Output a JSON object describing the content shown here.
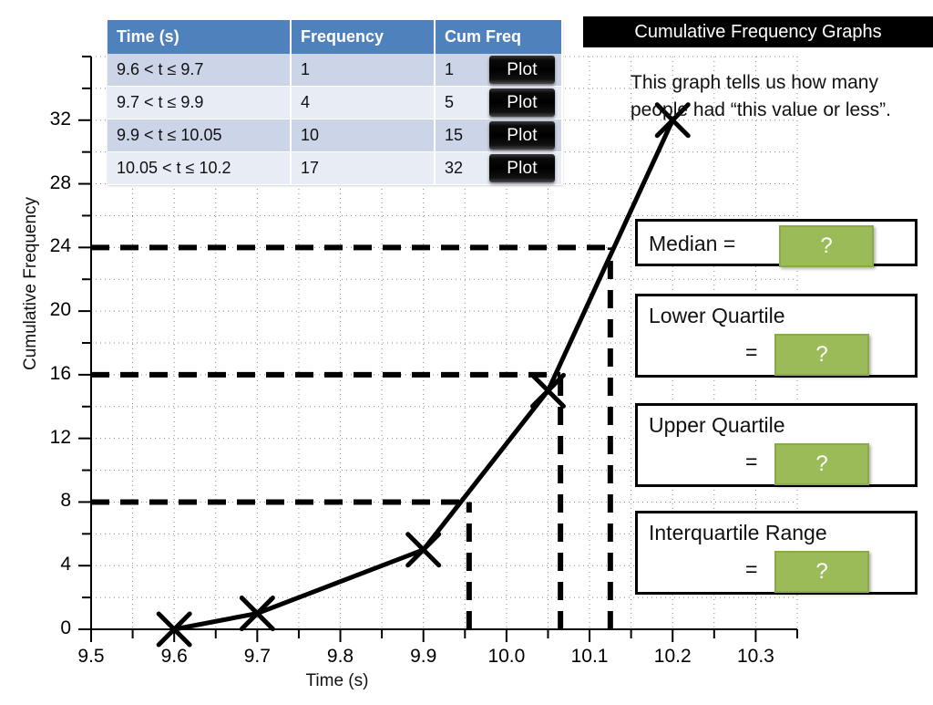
{
  "header": {
    "title": "Cumulative Frequency Graphs",
    "blurb": "This graph tells us how many people had “this value or less”."
  },
  "table": {
    "columns": [
      "Time (s)",
      "Frequency",
      "Cum Freq"
    ],
    "rows": [
      {
        "time": "9.6 < t ≤ 9.7",
        "frequency": "1",
        "cum_freq": "1",
        "plot_label": "Plot"
      },
      {
        "time": "9.7 < t ≤ 9.9",
        "frequency": "4",
        "cum_freq": "5",
        "plot_label": "Plot"
      },
      {
        "time": "9.9 < t ≤ 10.05",
        "frequency": "10",
        "cum_freq": "15",
        "plot_label": "Plot"
      },
      {
        "time": "10.05 < t ≤ 10.2",
        "frequency": "17",
        "cum_freq": "32",
        "plot_label": "Plot"
      }
    ]
  },
  "answers": [
    {
      "label": "Median =",
      "eq": "",
      "value": "?"
    },
    {
      "label": "Lower Quartile",
      "eq": "=",
      "value": "?"
    },
    {
      "label": "Upper Quartile",
      "eq": "=",
      "value": "?"
    },
    {
      "label": "Interquartile Range",
      "eq": "=",
      "value": "?"
    }
  ],
  "colors": {
    "header_blue": "#4F81BD",
    "row_odd": "#ccd5e8",
    "row_even": "#e7ecf5",
    "answer_green": "#9BBB59",
    "title_bar": "#000000",
    "curve": "#000000"
  },
  "chart_data": {
    "type": "line",
    "title": "",
    "xlabel": "Time (s)",
    "ylabel": "Cumulative Frequency",
    "xlim": [
      9.5,
      10.35
    ],
    "ylim": [
      0,
      36
    ],
    "xticks": [
      9.5,
      9.6,
      9.7,
      9.8,
      9.9,
      10.0,
      10.1,
      10.2,
      10.3
    ],
    "xtick_labels": [
      "9.5",
      "9.6",
      "9.7",
      "9.8",
      "9.9",
      "10.0",
      "10.1",
      "10.2",
      "10.3"
    ],
    "x_minor_step": 0.05,
    "yticks": [
      0,
      4,
      8,
      12,
      16,
      20,
      24,
      28,
      32
    ],
    "ytick_labels": [
      "0",
      "4",
      "8",
      "12",
      "16",
      "20",
      "24",
      "28",
      "32"
    ],
    "y_minor_step": 2,
    "grid": true,
    "legend": false,
    "marker": "x",
    "series": [
      {
        "name": "Cumulative frequency",
        "x": [
          9.6,
          9.7,
          9.9,
          10.05,
          10.2
        ],
        "values": [
          0,
          1,
          5,
          15,
          32
        ]
      }
    ],
    "guide_lines_horizontal": [
      {
        "y": 8,
        "x_from": 9.5,
        "x_to": 9.955,
        "style": "dashed"
      },
      {
        "y": 16,
        "x_from": 9.5,
        "x_to": 10.065,
        "style": "dashed"
      },
      {
        "y": 24,
        "x_from": 9.5,
        "x_to": 10.125,
        "style": "dashed"
      }
    ],
    "guide_lines_vertical": [
      {
        "x": 9.955,
        "y_from": 0,
        "y_to": 8,
        "style": "dashed"
      },
      {
        "x": 10.065,
        "y_from": 0,
        "y_to": 16,
        "style": "dashed"
      },
      {
        "x": 10.125,
        "y_from": 0,
        "y_to": 24,
        "style": "dashed"
      }
    ]
  }
}
